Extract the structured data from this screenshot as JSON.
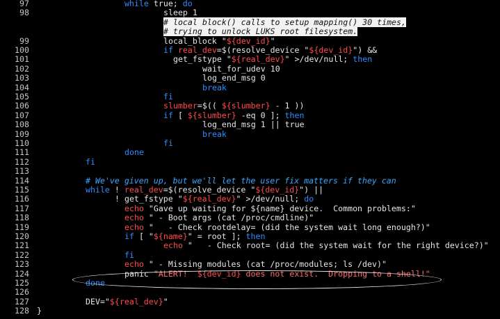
{
  "editor": {
    "lines": [
      {
        "n": "97",
        "i": 19,
        "t": [
          [
            "while",
            "kw"
          ],
          [
            " true; ",
            "p"
          ],
          [
            "do",
            "kw"
          ]
        ]
      },
      {
        "n": "98",
        "i": 27,
        "t": [
          [
            "sleep 1",
            "p"
          ]
        ]
      },
      {
        "n": "",
        "i": 27,
        "t": [
          [
            "# local_block() calls to setup_mapping() 30 times,",
            "hl"
          ]
        ]
      },
      {
        "n": "",
        "i": 27,
        "t": [
          [
            "# trying to unlock LUKS root filesystem.",
            "hl"
          ]
        ]
      },
      {
        "n": "99",
        "i": 27,
        "t": [
          [
            "local_block \"",
            "p"
          ],
          [
            "${dev_id}",
            "v"
          ],
          [
            "\"",
            "p"
          ]
        ]
      },
      {
        "n": "100",
        "i": 27,
        "t": [
          [
            "if",
            "kw"
          ],
          [
            " ",
            "p"
          ],
          [
            "real_dev",
            "v"
          ],
          [
            "=$(resolve_device \"",
            "p"
          ],
          [
            "${dev_id}",
            "v"
          ],
          [
            "\") &&",
            "p"
          ]
        ]
      },
      {
        "n": "101",
        "i": 29,
        "t": [
          [
            "get_fstype \"",
            "p"
          ],
          [
            "${real_dev}",
            "v"
          ],
          [
            "\" >/dev/null; ",
            "p"
          ],
          [
            "then",
            "kw"
          ]
        ]
      },
      {
        "n": "102",
        "i": 35,
        "t": [
          [
            "wait_for_udev 10",
            "p"
          ]
        ]
      },
      {
        "n": "103",
        "i": 35,
        "t": [
          [
            "log_end_msg 0",
            "p"
          ]
        ]
      },
      {
        "n": "104",
        "i": 35,
        "t": [
          [
            "break",
            "kw"
          ]
        ]
      },
      {
        "n": "105",
        "i": 27,
        "t": [
          [
            "fi",
            "kw"
          ]
        ]
      },
      {
        "n": "106",
        "i": 27,
        "t": [
          [
            "slumber",
            "v"
          ],
          [
            "=$(( ",
            "p"
          ],
          [
            "${slumber}",
            "v"
          ],
          [
            " - 1 ))",
            "p"
          ]
        ]
      },
      {
        "n": "107",
        "i": 27,
        "t": [
          [
            "if",
            "kw"
          ],
          [
            " [ ",
            "p"
          ],
          [
            "${slumber}",
            "v"
          ],
          [
            " -eq 0 ]; ",
            "p"
          ],
          [
            "then",
            "kw"
          ]
        ]
      },
      {
        "n": "108",
        "i": 35,
        "t": [
          [
            "log_end_msg 1 || true",
            "p"
          ]
        ]
      },
      {
        "n": "109",
        "i": 35,
        "t": [
          [
            "break",
            "kw"
          ]
        ]
      },
      {
        "n": "110",
        "i": 27,
        "t": [
          [
            "fi",
            "kw"
          ]
        ]
      },
      {
        "n": "111",
        "i": 19,
        "t": [
          [
            "done",
            "kw"
          ]
        ]
      },
      {
        "n": "112",
        "i": 11,
        "t": [
          [
            "fi",
            "kw"
          ]
        ]
      },
      {
        "n": "113",
        "i": 0,
        "t": []
      },
      {
        "n": "114",
        "i": 11,
        "t": [
          [
            "# We've given up, but we'll let the user fix matters if they can",
            "cm"
          ]
        ]
      },
      {
        "n": "115",
        "i": 11,
        "t": [
          [
            "while",
            "kw"
          ],
          [
            " ! ",
            "p"
          ],
          [
            "real_dev",
            "v"
          ],
          [
            "=$(resolve_device \"",
            "p"
          ],
          [
            "${dev_id}",
            "v"
          ],
          [
            "\") ||",
            "p"
          ]
        ]
      },
      {
        "n": "116",
        "i": 17,
        "t": [
          [
            "! get_fstype \"",
            "p"
          ],
          [
            "${real_dev}",
            "v"
          ],
          [
            "\" >/dev/null; ",
            "p"
          ],
          [
            "do",
            "kw"
          ]
        ]
      },
      {
        "n": "117",
        "i": 19,
        "t": [
          [
            "echo",
            "v"
          ],
          [
            " \"Gave up waiting for ${name} device.  Common problems:\"",
            "p"
          ]
        ]
      },
      {
        "n": "118",
        "i": 19,
        "t": [
          [
            "echo",
            "v"
          ],
          [
            " \" - Boot args (cat /proc/cmdline)\"",
            "p"
          ]
        ]
      },
      {
        "n": "119",
        "i": 19,
        "t": [
          [
            "echo",
            "v"
          ],
          [
            " \"   - Check rootdelay= (did the system wait long enough?)\"",
            "p"
          ]
        ]
      },
      {
        "n": "120",
        "i": 19,
        "t": [
          [
            "if",
            "kw"
          ],
          [
            " [ \"",
            "p"
          ],
          [
            "${name}",
            "v"
          ],
          [
            "\" = root ]; ",
            "p"
          ],
          [
            "then",
            "kw"
          ]
        ]
      },
      {
        "n": "121",
        "i": 27,
        "t": [
          [
            "echo",
            "v"
          ],
          [
            " \"   - Check root= (did the system wait for the right device?)\"",
            "p"
          ]
        ]
      },
      {
        "n": "122",
        "i": 19,
        "t": [
          [
            "fi",
            "kw"
          ]
        ]
      },
      {
        "n": "123",
        "i": 19,
        "t": [
          [
            "echo",
            "v"
          ],
          [
            " \" - Missing modules (cat /proc/modules; ls /dev)\"",
            "p"
          ]
        ]
      },
      {
        "n": "124",
        "i": 19,
        "t": [
          [
            "panic",
            "p"
          ],
          [
            " \"ALERT!  ",
            "s"
          ],
          [
            "${dev_id}",
            "v"
          ],
          [
            " does not exist.  Dropping to a shell!\"",
            "s"
          ]
        ]
      },
      {
        "n": "125",
        "i": 11,
        "t": [
          [
            "done",
            "kw"
          ]
        ]
      },
      {
        "n": "126",
        "i": 0,
        "t": []
      },
      {
        "n": "127",
        "i": 11,
        "t": [
          [
            "DEV",
            "p"
          ],
          [
            "=\"",
            "p"
          ],
          [
            "${real_dev}",
            "v"
          ],
          [
            "\"",
            "p"
          ]
        ]
      },
      {
        "n": "128",
        "i": 1,
        "t": [
          [
            "}",
            "p"
          ]
        ]
      }
    ]
  }
}
